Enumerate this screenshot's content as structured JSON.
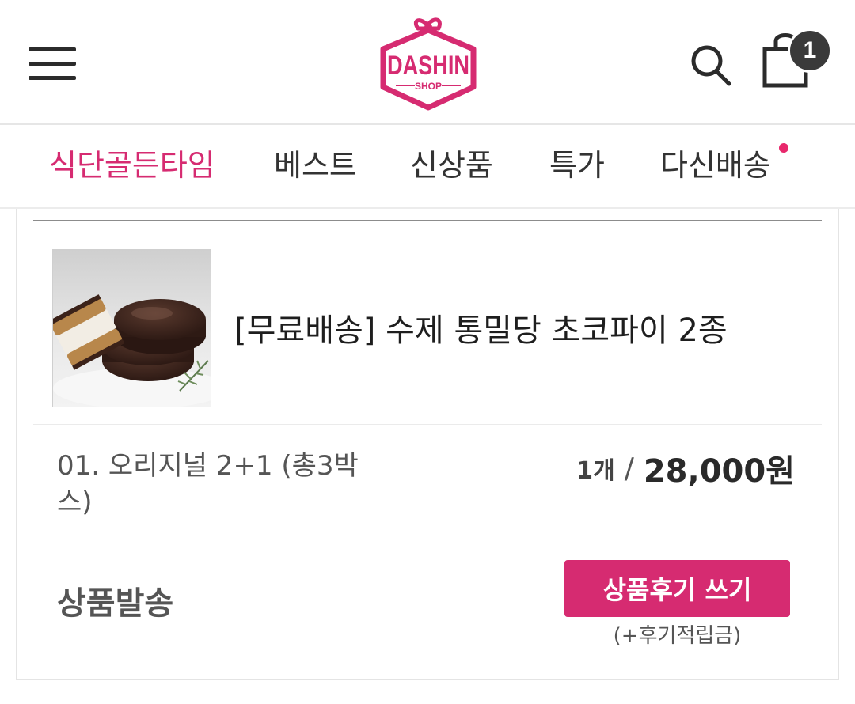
{
  "header": {
    "menu_icon": "hamburger-menu-icon",
    "logo_text": "DASHIN",
    "logo_subtext": "SHOP",
    "search_icon": "search-icon",
    "cart_icon": "shopping-bag-icon",
    "cart_count": "1"
  },
  "nav": {
    "items": [
      {
        "label": "식단골든타임",
        "active": true
      },
      {
        "label": "베스트",
        "active": false
      },
      {
        "label": "신상품",
        "active": false
      },
      {
        "label": "특가",
        "active": false
      },
      {
        "label": "다신배송",
        "active": false,
        "has_dot": true
      }
    ]
  },
  "order": {
    "product_name": "[무료배송] 수제 통밀당 초코파이 2종",
    "option": "01. 오리지널 2+1 (총3박스)",
    "quantity": "1개",
    "separator": "/",
    "price": "28,000원",
    "status": "상품발송",
    "review_button": "상품후기 쓰기",
    "review_note": "(+후기적립금)"
  },
  "colors": {
    "accent": "#d62b71",
    "badge": "#3a3a3a",
    "nav_dot": "#e8286c"
  }
}
